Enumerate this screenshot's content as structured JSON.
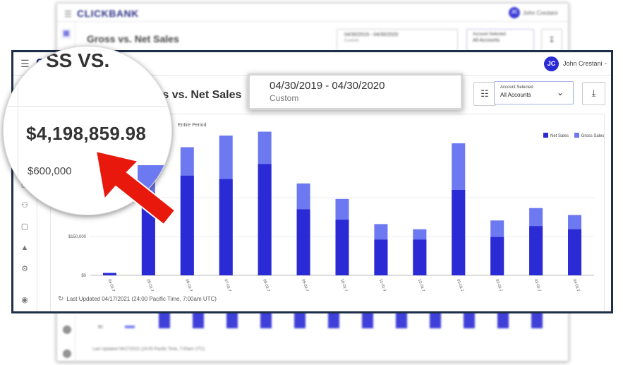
{
  "app": {
    "logo": "CLICKBANK",
    "user_initials": "JC",
    "user_name": "John Crestani",
    "page_title": "Gross vs. Net Sales"
  },
  "date_picker": {
    "range": "04/30/2019 - 04/30/2020",
    "sub": "Custom"
  },
  "account_select": {
    "label": "Account Selected",
    "value": "All Accounts"
  },
  "chart_card": {
    "period_label": "Entire Period",
    "updated": "Last Updated 04/17/2021 (24:00 Pacific Time, 7:00am UTC)"
  },
  "zoom": {
    "title_fragment": "SS VS.",
    "total": "$4,198,859.98",
    "y_label": "$600,000"
  },
  "colors": {
    "net_sales": "#2b2bd6",
    "gross_sales": "#6d79f0",
    "arrow": "#e8180c",
    "frame": "#1c2e4a"
  },
  "icons": {
    "menu": "hamburger-icon",
    "calendar": "calendar-icon",
    "download": "download-icon",
    "refresh": "refresh-icon",
    "grid": "grid-icon"
  },
  "chart_data": {
    "type": "bar",
    "stacked": true,
    "categories": [
      "04-01-19",
      "05-01-19",
      "06-01-19",
      "07-01-19",
      "08-01-19",
      "09-01-19",
      "10-01-19",
      "11-01-19",
      "12-01-19",
      "01-01-20",
      "02-01-20",
      "03-01-20",
      "04-01-20"
    ],
    "series": [
      {
        "name": "Net Sales",
        "values": [
          8000,
          320000,
          385000,
          372000,
          430000,
          255000,
          215000,
          138000,
          138000,
          330000,
          148000,
          190000,
          178000
        ]
      },
      {
        "name": "Gross Sales",
        "values": [
          10000,
          395000,
          495000,
          540000,
          555000,
          355000,
          295000,
          198000,
          178000,
          510000,
          212000,
          260000,
          233000
        ]
      }
    ],
    "y_ticks": [
      "$0",
      "$150,000",
      "$300,000"
    ],
    "ylim": [
      0,
      600000
    ],
    "legend_position": "top-right",
    "grid": true
  }
}
